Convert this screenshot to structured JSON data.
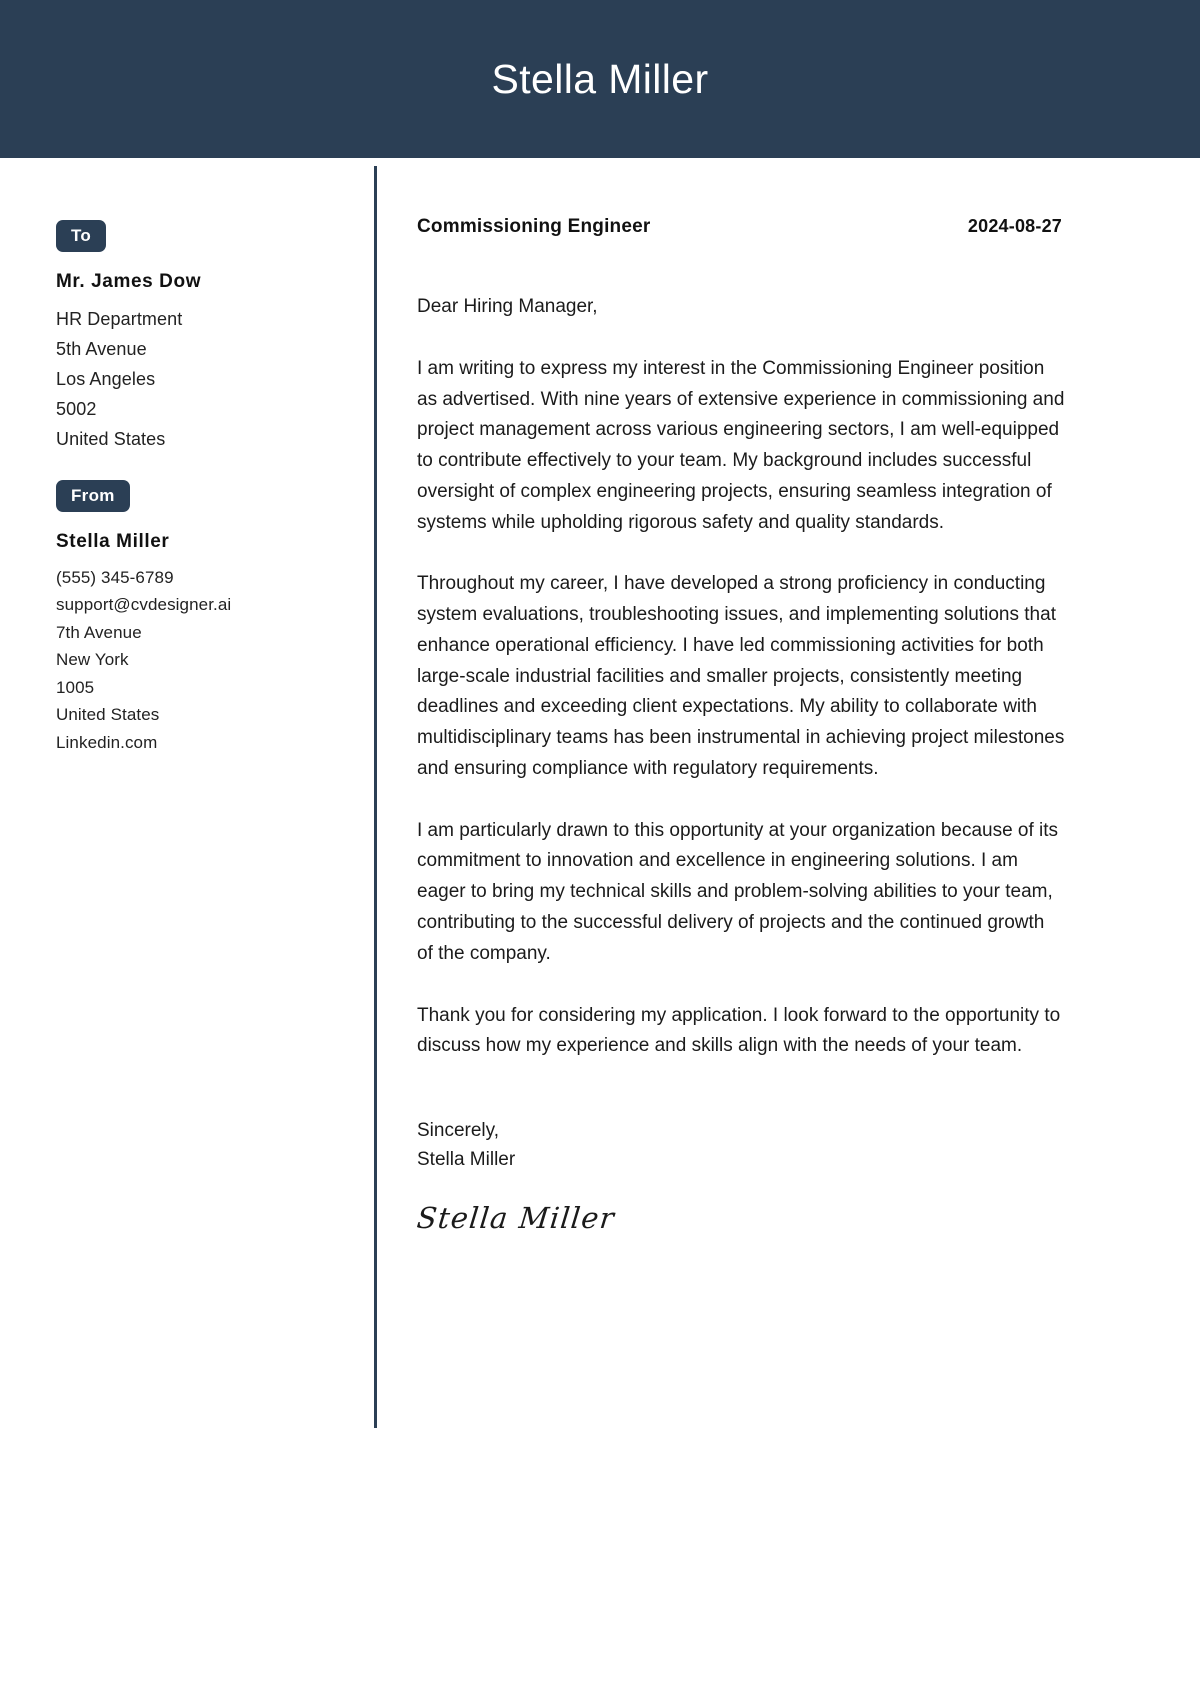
{
  "header": {
    "name": "Stella Miller",
    "background_color": "#2b3f55",
    "text_color": "#ffffff"
  },
  "sidebar": {
    "to": {
      "badge_label": "To",
      "name": "Mr. James Dow",
      "lines": [
        "HR Department",
        "5th Avenue",
        "Los Angeles",
        "5002",
        "United States"
      ]
    },
    "from": {
      "badge_label": "From",
      "name": "Stella Miller",
      "lines": [
        "(555) 345-6789",
        "support@cvdesigner.ai",
        "7th Avenue",
        "New York",
        "1005",
        "United States",
        "Linkedin.com"
      ]
    }
  },
  "letter": {
    "job_title": "Commissioning Engineer",
    "date": "2024-08-27",
    "salutation": "Dear Hiring Manager,",
    "paragraphs": [
      "I am writing to express my interest in the Commissioning Engineer position as advertised. With nine years of extensive experience in commissioning and project management across various engineering sectors, I am well-equipped to contribute effectively to your team. My background includes successful oversight of complex engineering projects, ensuring seamless integration of systems while upholding rigorous safety and quality standards.",
      "Throughout my career, I have developed a strong proficiency in conducting system evaluations, troubleshooting issues, and implementing solutions that enhance operational efficiency. I have led commissioning activities for both large-scale industrial facilities and smaller projects, consistently meeting deadlines and exceeding client expectations. My ability to collaborate with multidisciplinary teams has been instrumental in achieving project milestones and ensuring compliance with regulatory requirements.",
      "I am particularly drawn to this opportunity at your organization because of its commitment to innovation and excellence in engineering solutions. I am eager to bring my technical skills and problem-solving abilities to your team, contributing to the successful delivery of projects and the continued growth of the company.",
      "Thank you for considering my application. I look forward to the opportunity to discuss how my experience and skills align with the needs of your team."
    ],
    "closing_word": "Sincerely,",
    "closing_name": "Stella Miller",
    "signature": "Stella Miller"
  },
  "theme": {
    "accent_color": "#2b3f55",
    "page_background": "#ffffff",
    "text_color": "#1b1b1b"
  }
}
